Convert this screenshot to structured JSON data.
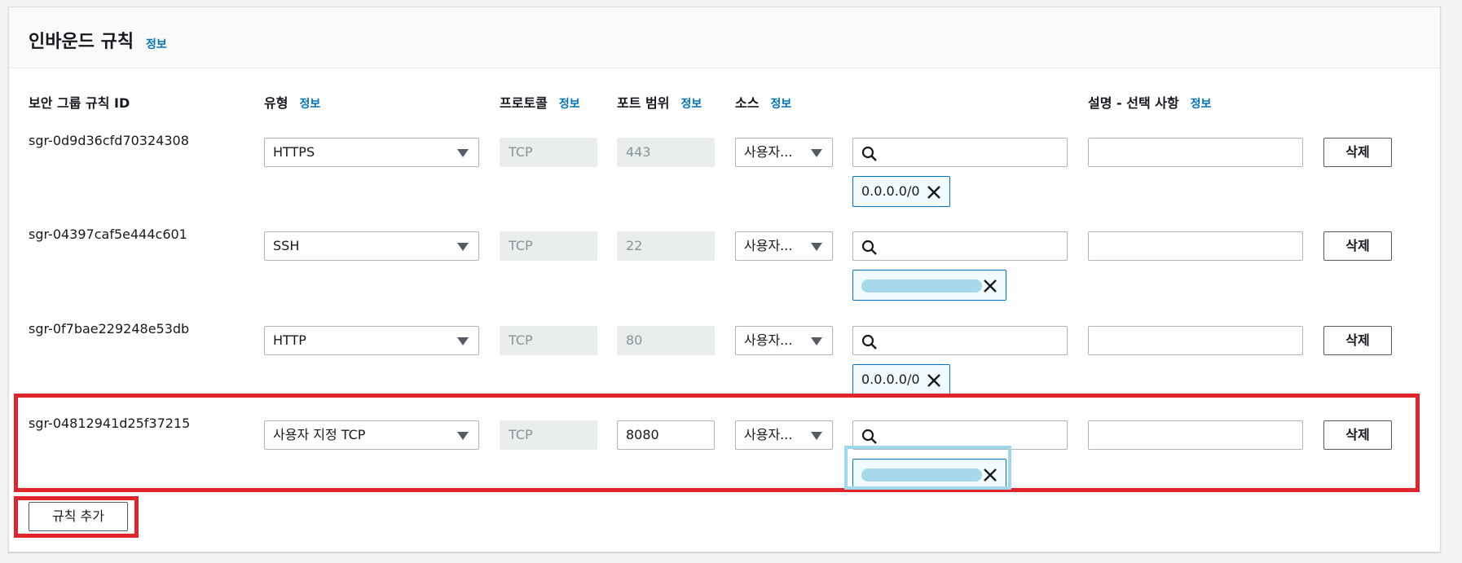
{
  "section": {
    "title": "인바운드 규칙",
    "info": "정보"
  },
  "columns": {
    "rule_id": "보안 그룹 규칙 ID",
    "type": "유형",
    "protocol": "프로토콜",
    "port_range": "포트 범위",
    "source": "소스",
    "description": "설명 - 선택 사항",
    "info": "정보"
  },
  "rules": [
    {
      "id": "sgr-0d9d36cfd70324308",
      "type": "HTTPS",
      "protocol": "TCP",
      "port": "443",
      "source": "사용자...",
      "token": "0.0.0.0/0",
      "delete": "삭제"
    },
    {
      "id": "sgr-04397caf5e444c601",
      "type": "SSH",
      "protocol": "TCP",
      "port": "22",
      "source": "사용자...",
      "token": "",
      "delete": "삭제"
    },
    {
      "id": "sgr-0f7bae229248e53db",
      "type": "HTTP",
      "protocol": "TCP",
      "port": "80",
      "source": "사용자...",
      "token": "0.0.0.0/0",
      "delete": "삭제"
    },
    {
      "id": "sgr-04812941d25f37215",
      "type": "사용자 지정 TCP",
      "protocol": "TCP",
      "port": "8080",
      "source": "사용자...",
      "token": "",
      "delete": "삭제"
    }
  ],
  "add_rule": "규칙 추가",
  "colors": {
    "link": "#0073bb",
    "highlight_red": "#e0242b",
    "highlight_blue": "#9fd8ea",
    "redaction": "#a4d8ea"
  }
}
